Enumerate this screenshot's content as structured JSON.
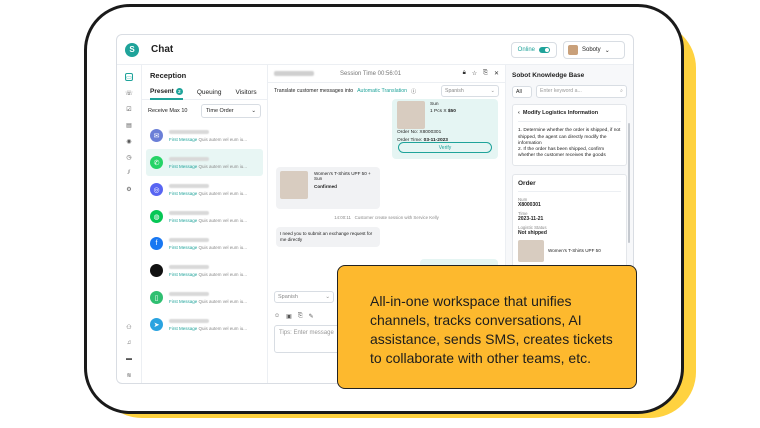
{
  "header": {
    "logo": "S",
    "title": "Chat",
    "online_label": "Online",
    "user_name": "Soboty"
  },
  "reception": {
    "title": "Reception",
    "tabs": [
      {
        "label": "Present",
        "count": "2"
      },
      {
        "label": "Queuing"
      },
      {
        "label": "Visitors"
      }
    ],
    "receive_label": "Receive Max 10",
    "order_select": "Time Order",
    "conversations": [
      {
        "channel": "email",
        "msg_tag": "First Message",
        "msg": "Quis autem vel eum iu...",
        "color": "#6b7fd7"
      },
      {
        "channel": "whatsapp",
        "msg_tag": "First Message",
        "msg": "Quis autem vel eum iu...",
        "color": "#25d366"
      },
      {
        "channel": "discord",
        "msg_tag": "First Message",
        "msg": "Quis autem vel eum iu...",
        "color": "#5865f2"
      },
      {
        "channel": "line",
        "msg_tag": "First Message",
        "msg": "Quis autem vel eum iu...",
        "color": "#06c755"
      },
      {
        "channel": "facebook",
        "msg_tag": "First Message",
        "msg": "Quis autem vel eum iu...",
        "color": "#1877f2"
      },
      {
        "channel": "apple",
        "msg_tag": "First Message",
        "msg": "Quis autem vel eum iu...",
        "color": "#111111"
      },
      {
        "channel": "sms",
        "msg_tag": "First Message",
        "msg": "Quis autem vel eum iu...",
        "color": "#2fbf71"
      },
      {
        "channel": "telegram",
        "msg_tag": "First Message",
        "msg": "Quis autem vel eum iu...",
        "color": "#2aa3e0"
      }
    ]
  },
  "chat": {
    "session": "Session Time 00:56:01",
    "translate_label": "Translate customer messages into",
    "auto_translation": "Automatic Translation",
    "lang": "Spanish",
    "order_card": {
      "item": "Sun",
      "qty": "1 Pcs",
      "x": "X",
      "price": "$50",
      "order_no": "Order No: X8000301",
      "order_time_label": "Order Time:",
      "order_time": "03-11-2023",
      "verify": "Verify"
    },
    "product_card": {
      "name": "Women's T-Shirts UPF 50 + Sun",
      "status": "Confirmed"
    },
    "system_time": "14:00:11",
    "system_msg": "Customer create session with Service Kelly",
    "customer_msg": "I need you to submit an exchange request for me directly",
    "composer_lang": "Spanish",
    "placeholder": "Tips: Enter message"
  },
  "knowledge": {
    "title": "Sobot Knowledge Base",
    "filter": "All",
    "search_placeholder": "Enter keyword a...",
    "article_title": "Modify Logistics Information",
    "steps": [
      "1. Determine whether the order is shipped, if not shipped, the agent can directly modify the information",
      "2. If the order has been shipped, confirm whether the customer receives the goods"
    ]
  },
  "order": {
    "title": "Order",
    "num_label": "Num",
    "num": "X8000301",
    "time_label": "Time",
    "time": "2023-11-21",
    "status_label": "Logistic Status",
    "status": "Not shipped",
    "item": "Women's T-Shirts UPF 50"
  },
  "callout": "All-in-one workspace that unifies channels, tracks conversations, AI assistance, sends SMS, creates tickets to collaborate with other teams, etc."
}
